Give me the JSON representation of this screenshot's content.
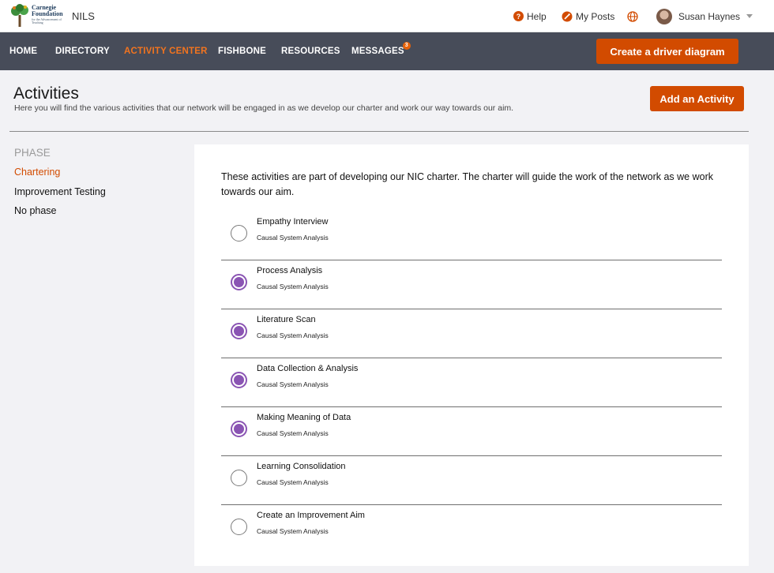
{
  "header": {
    "logo": {
      "line1": "Carnegie",
      "line2": "Foundation",
      "line3": "for the Advancement of Teaching"
    },
    "app_name": "NILS",
    "help_label": "Help",
    "myposts_label": "My Posts",
    "user_name": "Susan Haynes"
  },
  "nav": {
    "items": [
      {
        "label": "HOME"
      },
      {
        "label": "DIRECTORY"
      },
      {
        "label": "ACTIVITY CENTER"
      },
      {
        "label": "FISHBONE"
      },
      {
        "label": "RESOURCES"
      },
      {
        "label": "MESSAGES",
        "badge": "3"
      }
    ],
    "active": "ACTIVITY CENTER",
    "cta_label": "Create a driver diagram"
  },
  "page": {
    "title": "Activities",
    "subtitle": "Here you will find the various activities that our network will be engaged in as we develop our charter and work our way towards our aim.",
    "add_label": "Add an Activity"
  },
  "sidebar": {
    "heading": "PHASE",
    "items": [
      {
        "label": "Chartering"
      },
      {
        "label": "Improvement Testing"
      },
      {
        "label": "No phase"
      }
    ],
    "active": "Chartering"
  },
  "main": {
    "intro": "These activities are part of developing our NIC charter. The charter will guide the work of the network as we work towards our aim.",
    "activities": [
      {
        "name": "Empathy Interview",
        "category": "Causal System Analysis",
        "completed": false
      },
      {
        "name": "Process Analysis",
        "category": "Causal System Analysis",
        "completed": true
      },
      {
        "name": "Literature Scan",
        "category": "Causal System Analysis",
        "completed": true
      },
      {
        "name": "Data Collection & Analysis",
        "category": "Causal System Analysis",
        "completed": true
      },
      {
        "name": "Making Meaning of Data",
        "category": "Causal System Analysis",
        "completed": true
      },
      {
        "name": "Learning Consolidation",
        "category": "Causal System Analysis",
        "completed": false
      },
      {
        "name": "Create an Improvement Aim",
        "category": "Causal System Analysis",
        "completed": false
      }
    ]
  },
  "colors": {
    "accent": "#d24b00",
    "nav_active": "#f2741f",
    "nav_bg": "#474c59",
    "completed": "#8a54b3"
  },
  "icons": [
    "carnegie-tree-logo",
    "help-icon",
    "myposts-icon",
    "globe-icon",
    "avatar",
    "chevron-down-icon",
    "radio-circle"
  ]
}
